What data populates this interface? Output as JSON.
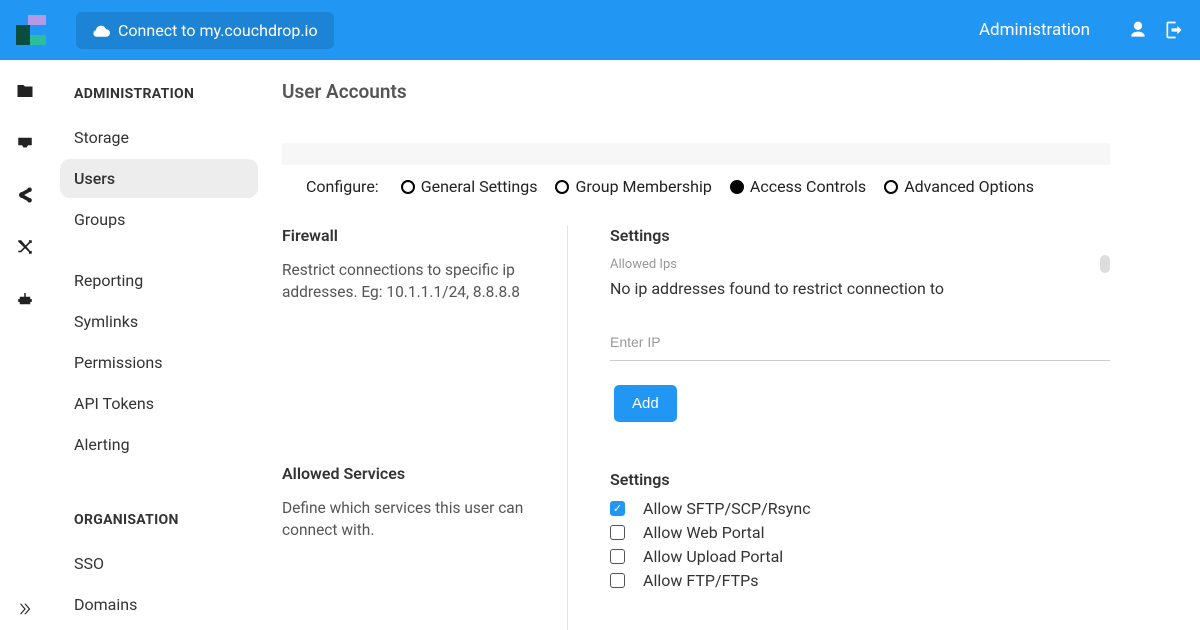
{
  "topbar": {
    "connect_label": "Connect to my.couchdrop.io",
    "admin_link": "Administration"
  },
  "sidebar": {
    "heading_admin": "ADMINISTRATION",
    "heading_org": "ORGANISATION",
    "items_admin": [
      "Storage",
      "Users",
      "Groups",
      "Reporting",
      "Symlinks",
      "Permissions",
      "API Tokens",
      "Alerting"
    ],
    "items_org": [
      "SSO",
      "Domains"
    ],
    "active": "Users"
  },
  "page": {
    "title": "User Accounts",
    "configure_label": "Configure:",
    "tabs": [
      {
        "label": "General Settings",
        "selected": false
      },
      {
        "label": "Group Membership",
        "selected": false
      },
      {
        "label": "Access Controls",
        "selected": true
      },
      {
        "label": "Advanced Options",
        "selected": false
      }
    ]
  },
  "firewall": {
    "title": "Firewall",
    "desc": "Restrict connections to specific ip addresses. Eg: 10.1.1.1/24, 8.8.8.8",
    "settings_title": "Settings",
    "allowed_label": "Allowed Ips",
    "empty_msg": "No ip addresses found to restrict connection to",
    "input_placeholder": "Enter IP",
    "add_label": "Add"
  },
  "services": {
    "title": "Allowed Services",
    "desc": "Define which services this user can connect with.",
    "settings_title": "Settings",
    "options": [
      {
        "label": "Allow SFTP/SCP/Rsync",
        "checked": true
      },
      {
        "label": "Allow Web Portal",
        "checked": false
      },
      {
        "label": "Allow Upload Portal",
        "checked": false
      },
      {
        "label": "Allow FTP/FTPs",
        "checked": false
      }
    ]
  }
}
